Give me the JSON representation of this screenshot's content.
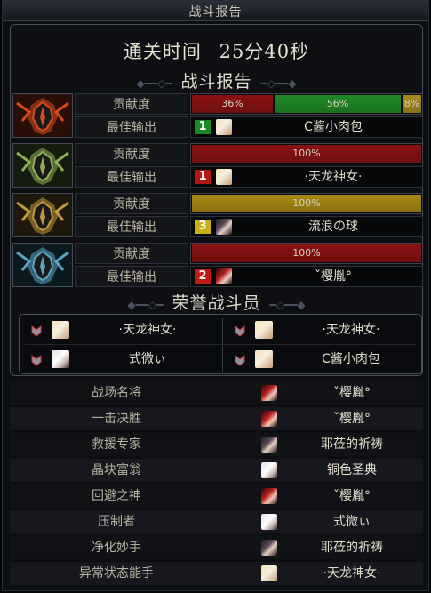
{
  "window": {
    "title": "战斗报告"
  },
  "clear": {
    "label": "通关时间",
    "time": "25分40秒"
  },
  "sections": {
    "report_title": "战斗报告",
    "honor_title": "荣誉战斗员"
  },
  "labels": {
    "contribution": "贡献度",
    "best_output": "最佳输出"
  },
  "bosses": [
    {
      "icon": "boss-emblem-red-icon",
      "segments": [
        {
          "text": "36%",
          "value": 36,
          "color": "#8a1111"
        },
        {
          "text": "56%",
          "value": 56,
          "color": "#1f8a25"
        },
        {
          "text": "8%",
          "value": 8,
          "color": "#a88a1a"
        }
      ],
      "best": {
        "badge": "1",
        "badge_color": "#1a8a22",
        "avatar": "av-blonde",
        "name": "C酱小肉包"
      }
    },
    {
      "icon": "boss-emblem-green-icon",
      "segments": [
        {
          "text": "100%",
          "value": 100,
          "color": "#8a1111"
        }
      ],
      "best": {
        "badge": "1",
        "badge_color": "#b51515",
        "avatar": "av-blonde",
        "name": "·天龙神女·"
      }
    },
    {
      "icon": "boss-emblem-gold-icon",
      "segments": [
        {
          "text": "100%",
          "value": 100,
          "color": "#a88a12"
        }
      ],
      "best": {
        "badge": "3",
        "badge_color": "#c9b014",
        "avatar": "av-dark",
        "name": "流浪の球"
      }
    },
    {
      "icon": "boss-emblem-blue-icon",
      "segments": [
        {
          "text": "100%",
          "value": 100,
          "color": "#8a1111"
        }
      ],
      "best": {
        "badge": "2",
        "badge_color": "#c21818",
        "avatar": "av-red",
        "name": "ˇ樱胤°"
      }
    }
  ],
  "honor": [
    {
      "avatar": "av-blonde",
      "name": "·天龙神女·"
    },
    {
      "avatar": "av-blonde",
      "name": "·天龙神女·"
    },
    {
      "avatar": "av-white",
      "name": "式微ぃ"
    },
    {
      "avatar": "av-blonde",
      "name": "C酱小肉包"
    }
  ],
  "awards": [
    {
      "title": "战场名将",
      "avatar": "av-red",
      "player": "ˇ樱胤°"
    },
    {
      "title": "一击决胜",
      "avatar": "av-red",
      "player": "ˇ樱胤°"
    },
    {
      "title": "救援专家",
      "avatar": "av-dark",
      "player": "耶莅的祈祷"
    },
    {
      "title": "晶块富翁",
      "avatar": "av-white",
      "player": "铜色圣典"
    },
    {
      "title": "回避之神",
      "avatar": "av-red",
      "player": "ˇ樱胤°"
    },
    {
      "title": "压制者",
      "avatar": "av-white",
      "player": "式微ぃ"
    },
    {
      "title": "净化妙手",
      "avatar": "av-dark",
      "player": "耶莅的祈祷"
    },
    {
      "title": "异常状态能手",
      "avatar": "av-blonde",
      "player": "·天龙神女·"
    }
  ]
}
